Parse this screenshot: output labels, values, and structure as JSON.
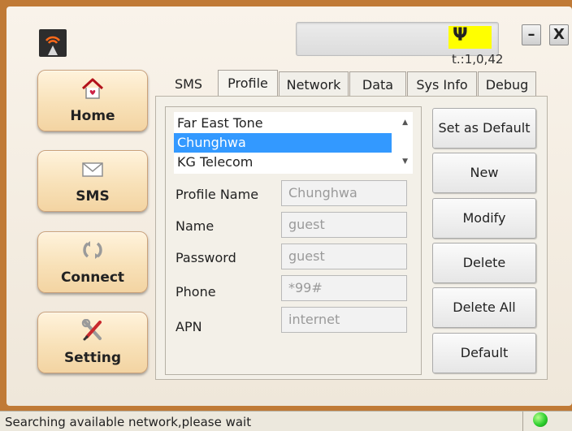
{
  "topbar": {
    "signal_text": "t.:1,0,42",
    "signal_glyph": "Ψ",
    "minimize_glyph": "–",
    "close_glyph": "X",
    "signal_highlight_color": "#ffff00"
  },
  "nav": {
    "items": [
      {
        "label": "Home",
        "icon": "home-icon"
      },
      {
        "label": "SMS",
        "icon": "envelope-icon"
      },
      {
        "label": "Connect",
        "icon": "connect-arrows-icon"
      },
      {
        "label": "Setting",
        "icon": "tools-icon"
      }
    ]
  },
  "tabs": [
    {
      "label": "SMS",
      "active": false
    },
    {
      "label": "Profile",
      "active": true
    },
    {
      "label": "Network",
      "active": false
    },
    {
      "label": "Data",
      "active": false
    },
    {
      "label": "Sys Info",
      "active": false
    },
    {
      "label": "Debug",
      "active": false
    }
  ],
  "profiles": {
    "items": [
      "Far East Tone",
      "Chunghwa",
      "KG Telecom"
    ],
    "selected": "Chunghwa"
  },
  "fields": [
    {
      "label": "Profile Name",
      "value": "Chunghwa"
    },
    {
      "label": "Name",
      "value": "guest"
    },
    {
      "label": "Password",
      "value": "guest"
    },
    {
      "label": "Phone",
      "value": "*99#"
    },
    {
      "label": "APN",
      "value": "internet"
    }
  ],
  "actions": [
    "Set as Default",
    "New",
    "Modify",
    "Delete",
    "Delete All",
    "Default"
  ],
  "status": {
    "text": "Searching available network,please wait",
    "indicator_color": "#2fcf2f"
  }
}
